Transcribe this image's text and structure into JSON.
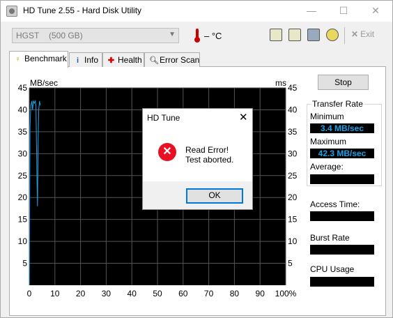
{
  "window": {
    "title": "HD Tune 2.55 - Hard Disk Utility",
    "min_glyph": "—",
    "max_glyph": "☐",
    "close_glyph": "✕"
  },
  "toolbar": {
    "drive_model": "HGST",
    "drive_size": "(500 GB)",
    "temperature": "– °C",
    "exit_label": "Exit",
    "icons": [
      "copy-text-icon",
      "copy-image-icon",
      "save-icon",
      "options-icon"
    ]
  },
  "tabs": [
    {
      "label": "Benchmark",
      "icon": "benchmark-icon",
      "active": true
    },
    {
      "label": "Info",
      "icon": "info-icon"
    },
    {
      "label": "Health",
      "icon": "health-icon"
    },
    {
      "label": "Error Scan",
      "icon": "error-scan-icon"
    }
  ],
  "benchmark": {
    "stop_label": "Stop",
    "transfer_rate_title": "Transfer Rate",
    "minimum_label": "Minimum",
    "minimum_value": "3.4 MB/sec",
    "maximum_label": "Maximum",
    "maximum_value": "42.3 MB/sec",
    "average_label": "Average:",
    "average_value": "",
    "access_time_label": "Access Time:",
    "access_time_value": "",
    "burst_rate_label": "Burst Rate",
    "burst_rate_value": "",
    "cpu_usage_label": "CPU Usage",
    "cpu_usage_value": ""
  },
  "chart_data": {
    "type": "line",
    "ylabel_left": "MB/sec",
    "ylabel_right": "ms",
    "ylim": [
      0,
      45
    ],
    "y_ticks": [
      "45",
      "40",
      "35",
      "30",
      "25",
      "20",
      "15",
      "10",
      "5"
    ],
    "x_ticks": [
      "0",
      "10",
      "20",
      "30",
      "40",
      "50",
      "60",
      "70",
      "80",
      "90",
      "100%"
    ],
    "xlim": [
      0,
      100
    ],
    "grid": true,
    "background": "#000000",
    "line_color": "#1aa2e8",
    "series": [
      {
        "x": [
          0,
          0.3,
          0.6,
          1.0,
          1.3,
          1.6,
          2.0,
          2.3,
          2.6,
          3.0,
          3.2,
          3.4,
          3.7,
          4.0,
          4.3
        ],
        "y": [
          0,
          36,
          41,
          42,
          40,
          42,
          41.5,
          42,
          41,
          25,
          18,
          30,
          40,
          42,
          41
        ]
      }
    ]
  },
  "dialog": {
    "title": "HD Tune",
    "close_glyph": "✕",
    "message_line1": "Read Error!",
    "message_line2": "Test aborted.",
    "ok_label": "OK",
    "error_glyph": "✕"
  }
}
